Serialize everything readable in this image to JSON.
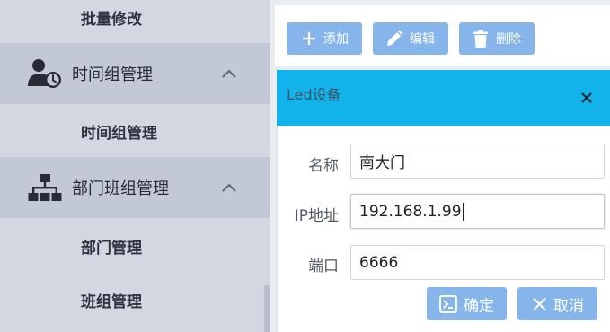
{
  "sidebar": {
    "items": [
      {
        "label": "批量修改",
        "type": "sub"
      },
      {
        "label": "时间组管理",
        "type": "group",
        "icon": "user-clock-icon",
        "expanded": true
      },
      {
        "label": "时间组管理",
        "type": "sub"
      },
      {
        "label": "部门班组管理",
        "type": "group",
        "icon": "org-chart-icon",
        "expanded": true
      },
      {
        "label": "部门管理",
        "type": "sub"
      },
      {
        "label": "班组管理",
        "type": "sub"
      }
    ]
  },
  "toolbar": {
    "add_label": "添加",
    "edit_label": "编辑",
    "delete_label": "删除"
  },
  "dialog": {
    "title": "Led设备",
    "fields": [
      {
        "label": "名称",
        "value": "南大门"
      },
      {
        "label": "IP地址",
        "value": "192.168.1.99"
      },
      {
        "label": "端口",
        "value": "6666"
      }
    ],
    "confirm_label": "确定",
    "cancel_label": "取消"
  },
  "colors": {
    "sidebar_bg": "#d2d7e2",
    "group_bg": "#c2c8d5",
    "dialog_header": "#12b2eb",
    "button": "#86b5ec"
  }
}
